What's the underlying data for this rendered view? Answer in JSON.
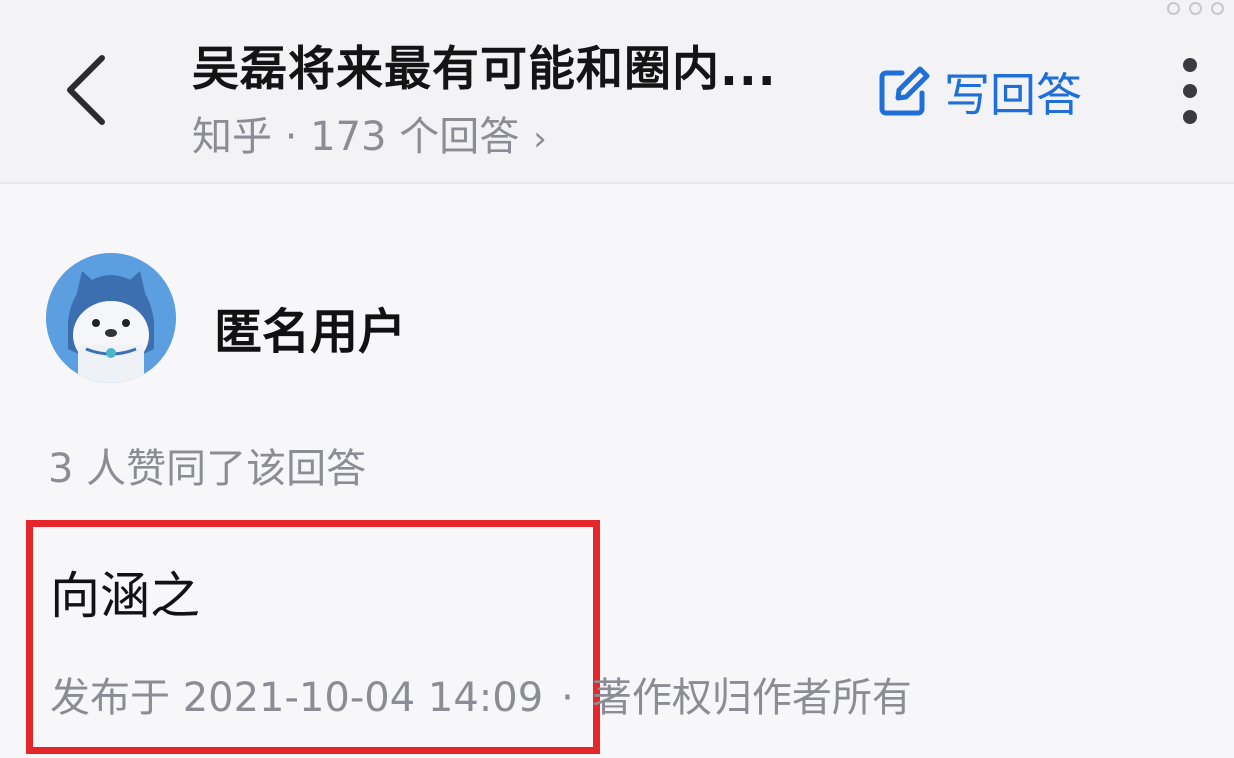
{
  "header": {
    "title": "吴磊将来最有可能和圈内...",
    "subtitle": "知乎 · 173 个回答",
    "subtitle_chevron": "›",
    "write_answer_label": "写回答",
    "accent_color": "#1e6fd9"
  },
  "answer": {
    "author_name": "匿名用户",
    "vote_summary": "3 人赞同了该回答",
    "content": "向涵之",
    "published": "发布于 2021-10-04 14:09",
    "meta_separator": "·",
    "copyright": "著作权归作者所有",
    "highlight_color": "#e5262b"
  },
  "icons": {
    "back": "back-arrow-icon",
    "write": "edit-icon",
    "more": "more-vertical-icon",
    "avatar": "anonymous-avatar"
  }
}
